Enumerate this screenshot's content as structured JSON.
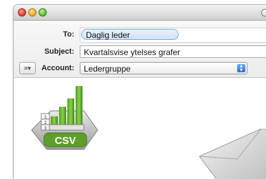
{
  "window": {
    "controls": [
      "close",
      "minimize",
      "maximize"
    ]
  },
  "header": {
    "to_label": "To:",
    "to_value": "Daglig leder",
    "subject_label": "Subject:",
    "subject_value": "Kvartalsvise ytelses grafer",
    "account_label": "Account:",
    "account_value": "Ledergruppe"
  },
  "attachment": {
    "icon": "csv-file-icon",
    "text": "CSV",
    "color": "#6aa52a"
  },
  "decor": {
    "icon": "envelope-icon"
  },
  "colors": {
    "to_token_border": "#7fa9d6",
    "select_arrow": "#2a6fd1"
  }
}
